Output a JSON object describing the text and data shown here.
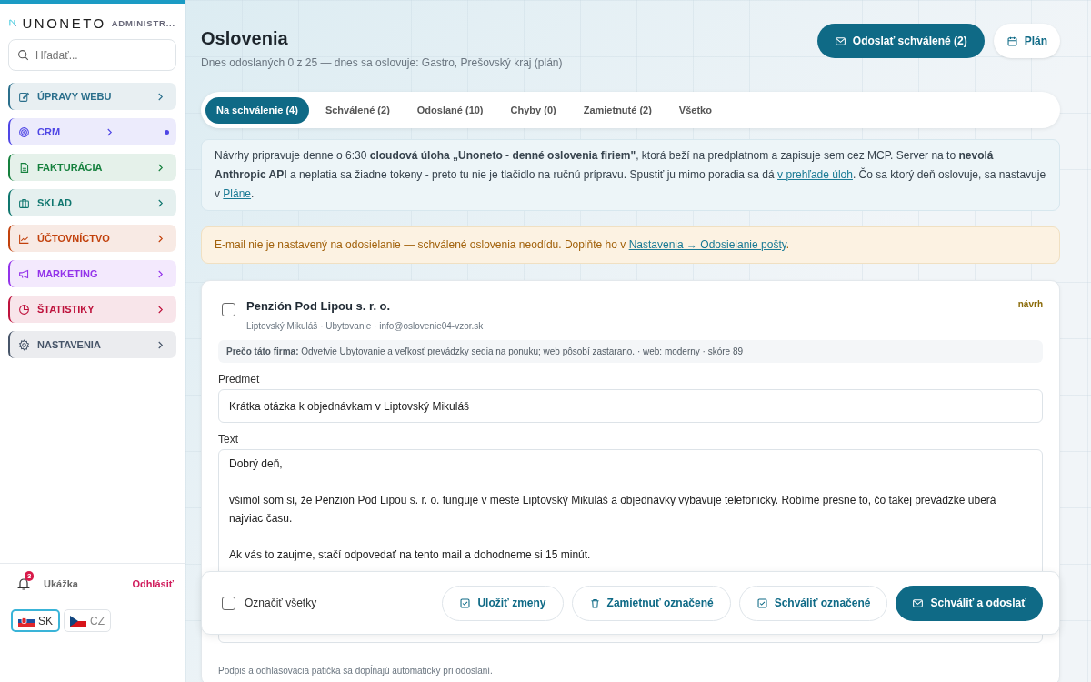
{
  "sidebar": {
    "brand": "UNONETO",
    "brand_sub": "ADMINISTR...",
    "search": {
      "placeholder": "Hľadať..."
    },
    "items": [
      {
        "label": "ÚPRAVY WEBU",
        "color": "#2b6f8c",
        "dot": false
      },
      {
        "label": "CRM",
        "color": "#4f46e5",
        "dot": true
      },
      {
        "label": "FAKTURÁCIA",
        "color": "#15803d",
        "dot": false
      },
      {
        "label": "SKLAD",
        "color": "#0f766e",
        "dot": false
      },
      {
        "label": "ÚČTOVNÍCTVO",
        "color": "#c2410c",
        "dot": false
      },
      {
        "label": "MARKETING",
        "color": "#9333ea",
        "dot": false
      },
      {
        "label": "ŠTATISTIKY",
        "color": "#be123c",
        "dot": false
      },
      {
        "label": "NASTAVENIA",
        "color": "#475569",
        "dot": false
      }
    ],
    "user": {
      "notifications": "3",
      "name": "Ukážka",
      "logout": "Odhlásiť"
    },
    "languages": [
      {
        "code": "SK",
        "selected": true
      },
      {
        "code": "CZ",
        "selected": false
      }
    ]
  },
  "header": {
    "title": "Oslovenia",
    "subtitle": "Dnes odoslaných 0 z 25 — dnes sa oslovuje: Gastro, Prešovský kraj (plán)",
    "buttons": [
      {
        "label": "Odoslať schválené (2)",
        "kind": "primary"
      },
      {
        "label": "Plán",
        "kind": "secondary"
      }
    ]
  },
  "tabs": [
    {
      "label": "Na schválenie (4)",
      "selected": true
    },
    {
      "label": "Schválené (2)",
      "selected": false
    },
    {
      "label": "Odoslané (10)",
      "selected": false
    },
    {
      "label": "Chyby (0)",
      "selected": false
    },
    {
      "label": "Zamietnuté (2)",
      "selected": false
    },
    {
      "label": "Všetko",
      "selected": false
    }
  ],
  "info": [
    {
      "kind": "text",
      "text": "Návrhy pripravuje denne o 6:30 **cloudová úloha „Unoneto - denné oslovenia firiem\"**, ktorá beží na predplatnom a zapisuje sem cez MCP. Server na to **nevolá Anthropic API** a neplatia sa žiadne tokeny - preto tu nie je tlačidlo na ručnú prípravu. Spustiť ju mimo poradia sa dá "
    },
    {
      "kind": "link",
      "text": "v prehľade úloh"
    },
    {
      "kind": "text",
      "text": ". Čo sa ktorý deň oslovuje, sa nastavuje v "
    },
    {
      "kind": "link",
      "text": "Pláne"
    },
    {
      "kind": "text",
      "text": "."
    }
  ],
  "warning": [
    {
      "kind": "text",
      "text": "E-mail nie je nastavený na odosielanie — schválené oslovenia neodídu. Doplňte ho v "
    },
    {
      "kind": "link",
      "text": "Nastavenia → Odosielanie pošty"
    },
    {
      "kind": "text",
      "text": "."
    }
  ],
  "card": {
    "selected": false,
    "company": "Penzión Pod Lipou s. r. o.",
    "status": "návrh",
    "meta": "Liptovský Mikuláš · Ubytovanie · info@oslovenie04-vzor.sk",
    "reason": "**Prečo táto firma:** Odvetvie Ubytovanie a veľkosť prevádzky sedia na ponuku; web pôsobí zastarano. · web: moderny · skóre 89",
    "subject_label": "Predmet",
    "subject": "Krátka otázka k objednávkam v Liptovský Mikuláš",
    "body_label": "Text",
    "body": [
      "Dobrý deň,",
      "všimol som si, že Penzión Pod Lipou s. r. o. funguje v meste Liptovský Mikuláš a objednávky vybavuje telefonicky. Robíme presne to, čo takej prevádzke uberá najviac času.",
      "Ak vás to zaujme, stačí odpovedať na tento mail a dohodneme si 15 minút."
    ],
    "note": "Podpis a odhlasovacia pätička sa dopĺňajú automaticky pri odoslaní."
  },
  "action_bar": {
    "select_all": {
      "label": "Označiť všetky",
      "checked": false
    },
    "buttons": [
      {
        "label": "Uložiť zmeny",
        "kind": "outline"
      },
      {
        "label": "Zamietnuť označené",
        "kind": "outline"
      },
      {
        "label": "Schváliť označené",
        "kind": "outline"
      },
      {
        "label": "Schváliť a odoslať",
        "kind": "primary"
      }
    ]
  }
}
